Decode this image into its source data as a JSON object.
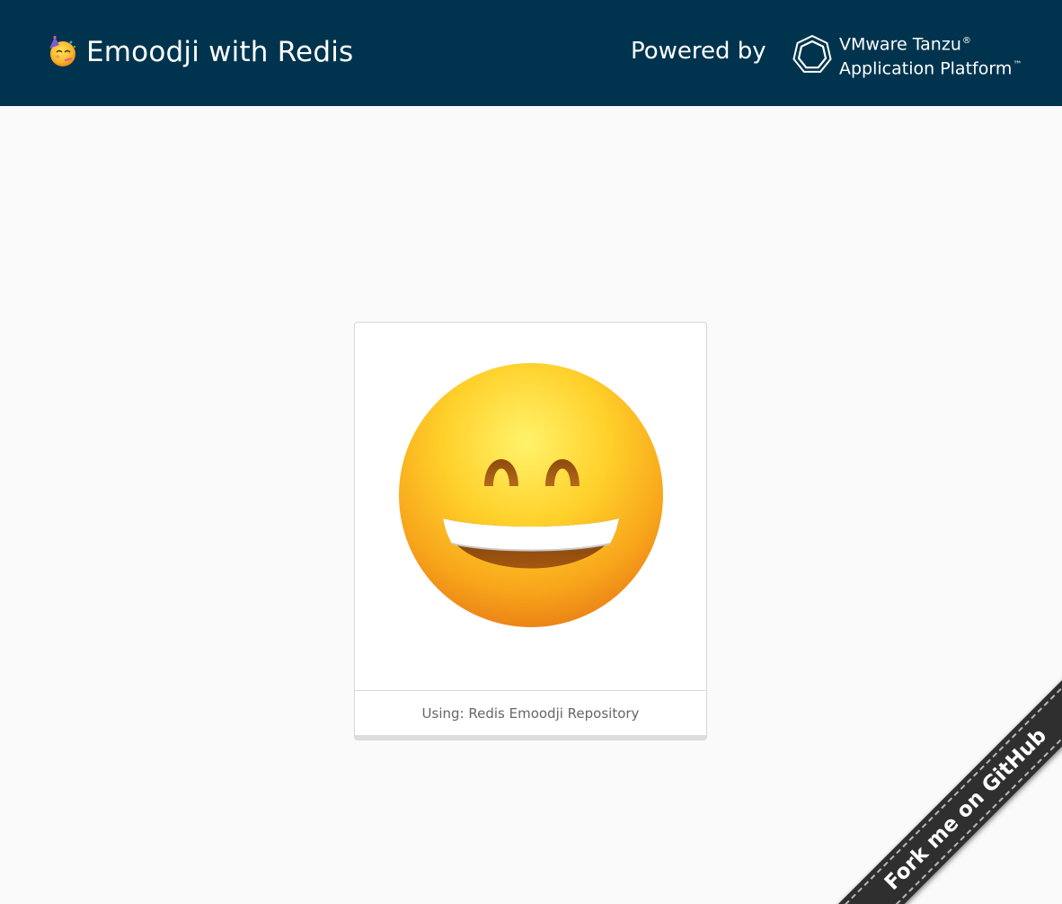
{
  "header": {
    "title": "Emoodji with Redis",
    "brand_icon": "party-face-icon",
    "powered_by": "Powered by",
    "vendor": {
      "logo_icon": "vmware-tanzu-heptagon-icon",
      "line1": "VMware Tanzu",
      "line1_mark": "®",
      "line2": "Application Platform",
      "line2_mark": "™"
    },
    "background": "#00344e"
  },
  "card": {
    "image_icon": "grinning-face-with-smiling-eyes-icon",
    "footer_text": "Using: Redis Emoodji Repository"
  },
  "ribbon": {
    "label": "Fork me on GitHub",
    "color": "#2f2f2f"
  }
}
